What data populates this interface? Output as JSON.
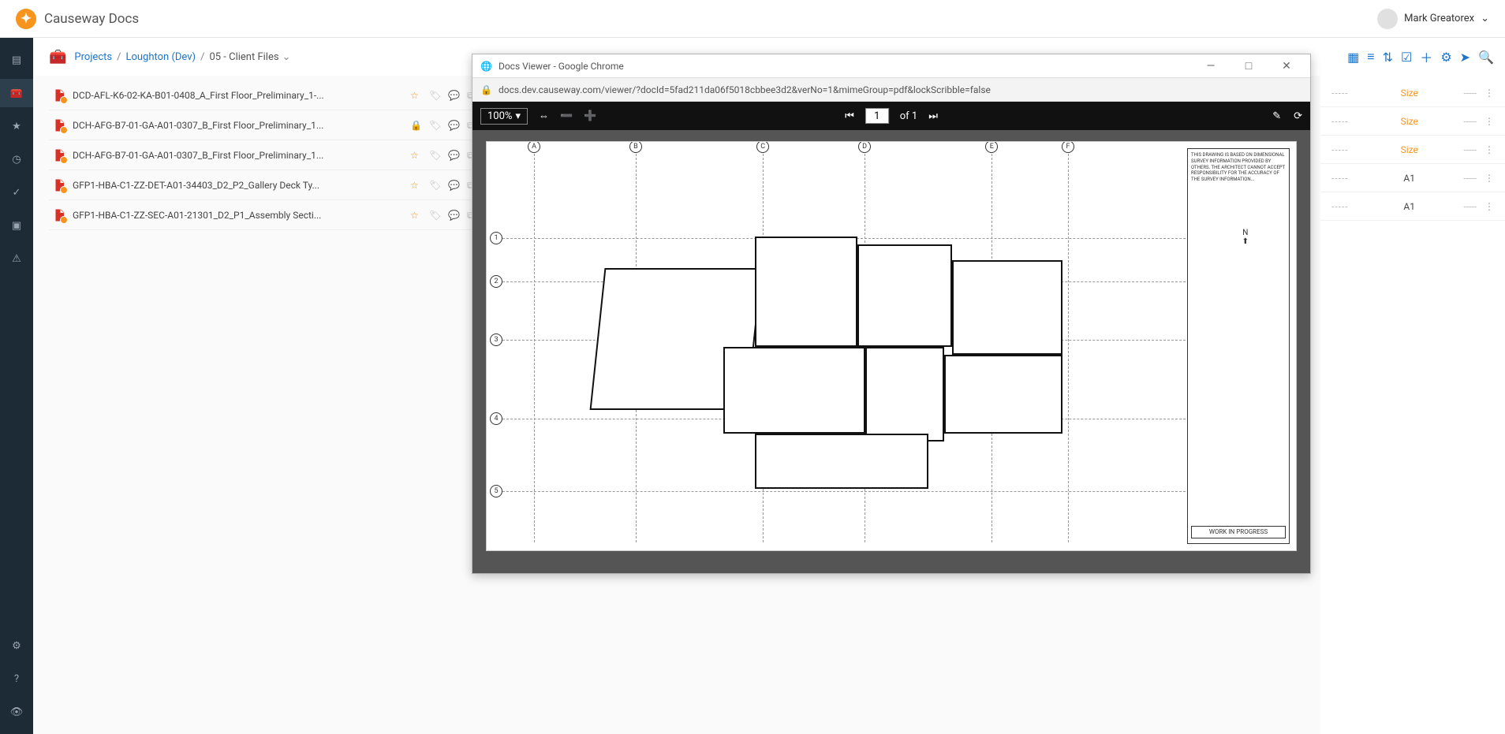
{
  "app": {
    "title": "Causeway Docs"
  },
  "user": {
    "name": "Mark Greatorex"
  },
  "breadcrumb": {
    "root": "Projects",
    "project": "Loughton (Dev)",
    "folder": "05 - Client Files"
  },
  "files": [
    {
      "name": "DCD-AFL-K6-02-KA-B01-0408_A_First Floor_Preliminary_1-...",
      "selected": false,
      "locked": false
    },
    {
      "name": "DCH-AFG-B7-01-GA-A01-0307_B_First Floor_Preliminary_1...",
      "selected": true,
      "locked": true
    },
    {
      "name": "DCH-AFG-B7-01-GA-A01-0307_B_First Floor_Preliminary_1...",
      "selected": false,
      "locked": false
    },
    {
      "name": "GFP1-HBA-C1-ZZ-DET-A01-34403_D2_P2_Gallery Deck Ty...",
      "selected": false,
      "locked": false
    },
    {
      "name": "GFP1-HBA-C1-ZZ-SEC-A01-21301_D2_P1_Assembly Secti...",
      "selected": false,
      "locked": false
    }
  ],
  "props": [
    {
      "label": "Size",
      "link": true
    },
    {
      "label": "Size",
      "link": true
    },
    {
      "label": "Size",
      "link": true
    },
    {
      "label": "A1",
      "link": false
    },
    {
      "label": "A1",
      "link": false
    }
  ],
  "viewer": {
    "windowTitle": "Docs Viewer - Google Chrome",
    "url": "docs.dev.causeway.com/viewer/?docId=5fad211da06f5018cbbee3d2&verNo=1&mimeGroup=pdf&lockScribble=false",
    "zoom": "100%",
    "page": "1",
    "pageOf": "of 1",
    "wip": "WORK IN PROGRESS"
  }
}
